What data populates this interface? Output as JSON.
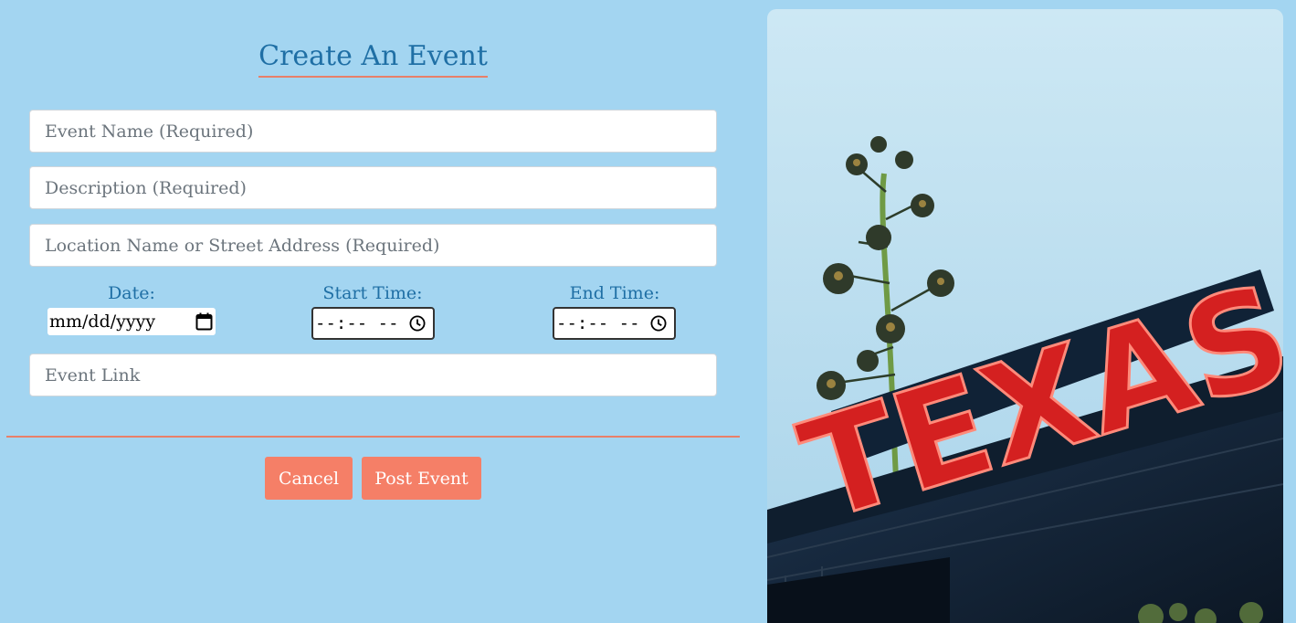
{
  "form": {
    "title": "Create An Event",
    "event_name_placeholder": "Event Name (Required)",
    "description_placeholder": "Description (Required)",
    "location_placeholder": "Location Name or Street Address (Required)",
    "date_label": "Date:",
    "date_value": "mm/dd/yyyy",
    "start_time_label": "Start Time:",
    "start_time_value": "--:-- --",
    "end_time_label": "End Time:",
    "end_time_value": "--:-- --",
    "event_link_placeholder": "Event Link"
  },
  "actions": {
    "cancel_label": "Cancel",
    "post_label": "Post Event"
  },
  "photo": {
    "sign_text": "TEXAS"
  },
  "colors": {
    "background": "#a3d5f1",
    "accent": "#f57f67",
    "heading": "#1f6fa5",
    "divider": "#e8806a",
    "neon_red": "#e0231f"
  }
}
